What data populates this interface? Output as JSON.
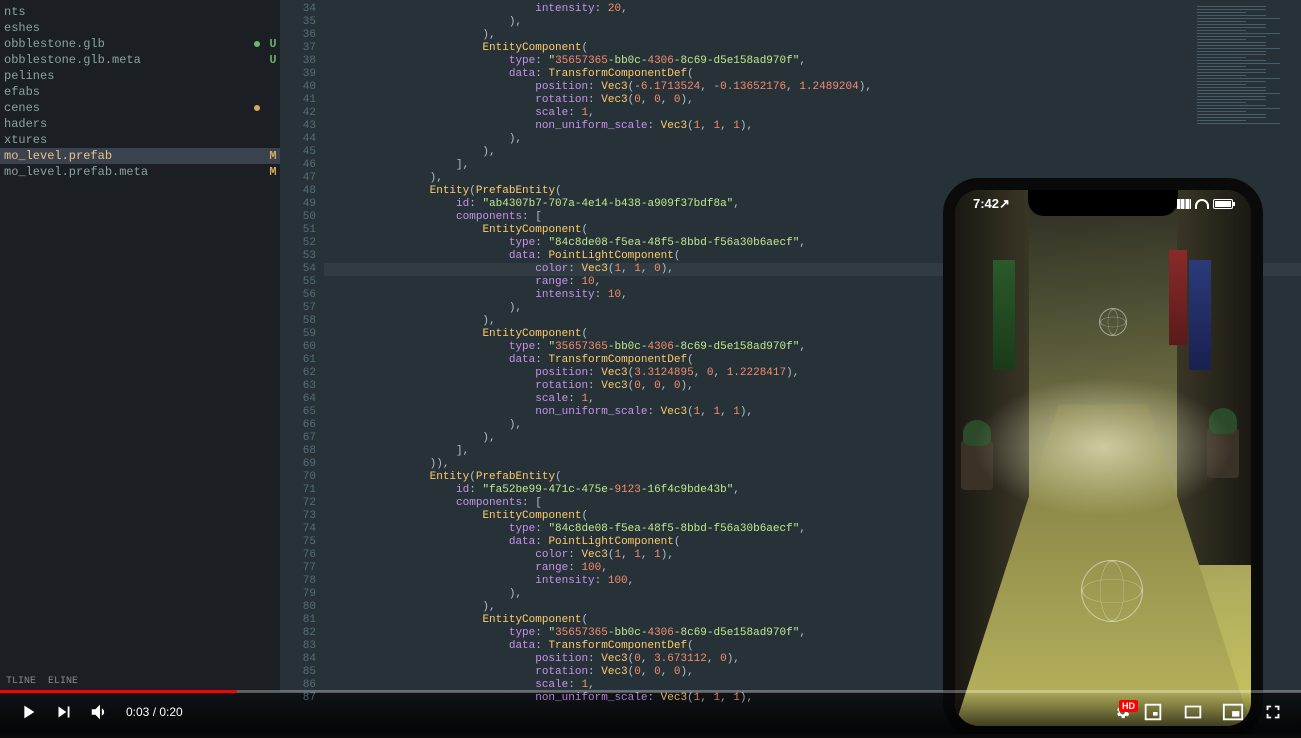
{
  "player": {
    "current_time": "0:03",
    "total_time": "0:20",
    "time_display": "0:03 / 0:20",
    "progress_percent": 18.2,
    "hd_badge": "HD"
  },
  "phone": {
    "time": "7:42",
    "location_icon": "↗"
  },
  "sidebar": {
    "items": [
      {
        "label": "nts",
        "badge": ""
      },
      {
        "label": "eshes",
        "badge": ""
      },
      {
        "label": "obblestone.glb",
        "badge": "U",
        "dot": "green"
      },
      {
        "label": "obblestone.glb.meta",
        "badge": "U"
      },
      {
        "label": "pelines",
        "badge": ""
      },
      {
        "label": "efabs",
        "badge": ""
      },
      {
        "label": "cenes",
        "badge": "",
        "dot": "orange"
      },
      {
        "label": "haders",
        "badge": ""
      },
      {
        "label": "xtures",
        "badge": ""
      },
      {
        "label": "mo_level.prefab",
        "badge": "M",
        "sel": true
      },
      {
        "label": "mo_level.prefab.meta",
        "badge": "M"
      }
    ],
    "bottom_tabs": [
      "TLINE",
      "ELINE"
    ]
  },
  "code_lines": [
    {
      "n": 34,
      "t": "                                intensity: 20,"
    },
    {
      "n": 35,
      "t": "                            ),"
    },
    {
      "n": 36,
      "t": "                        ),"
    },
    {
      "n": 37,
      "t": "                        EntityComponent("
    },
    {
      "n": 38,
      "t": "                            type: \"35657365-bb0c-4306-8c69-d5e158ad970f\","
    },
    {
      "n": 39,
      "t": "                            data: TransformComponentDef("
    },
    {
      "n": 40,
      "t": "                                position: Vec3(-6.1713524, -0.13652176, 1.2489204),"
    },
    {
      "n": 41,
      "t": "                                rotation: Vec3(0, 0, 0),"
    },
    {
      "n": 42,
      "t": "                                scale: 1,"
    },
    {
      "n": 43,
      "t": "                                non_uniform_scale: Vec3(1, 1, 1),"
    },
    {
      "n": 44,
      "t": "                            ),"
    },
    {
      "n": 45,
      "t": "                        ),"
    },
    {
      "n": 46,
      "t": "                    ],"
    },
    {
      "n": 47,
      "t": "                ),"
    },
    {
      "n": 48,
      "t": "                Entity(PrefabEntity("
    },
    {
      "n": 49,
      "t": "                    id: \"ab4307b7-707a-4e14-b438-a909f37bdf8a\","
    },
    {
      "n": 50,
      "t": "                    components: ["
    },
    {
      "n": 51,
      "t": "                        EntityComponent("
    },
    {
      "n": 52,
      "t": "                            type: \"84c8de08-f5ea-48f5-8bbd-f56a30b6aecf\","
    },
    {
      "n": 53,
      "t": "                            data: PointLightComponent("
    },
    {
      "n": 54,
      "t": "                                color: Vec3(1, 1, 0),",
      "hl": true
    },
    {
      "n": 55,
      "t": "                                range: 10,"
    },
    {
      "n": 56,
      "t": "                                intensity: 10,"
    },
    {
      "n": 57,
      "t": "                            ),"
    },
    {
      "n": 58,
      "t": "                        ),"
    },
    {
      "n": 59,
      "t": "                        EntityComponent("
    },
    {
      "n": 60,
      "t": "                            type: \"35657365-bb0c-4306-8c69-d5e158ad970f\","
    },
    {
      "n": 61,
      "t": "                            data: TransformComponentDef("
    },
    {
      "n": 62,
      "t": "                                position: Vec3(3.3124895, 0, 1.2228417),"
    },
    {
      "n": 63,
      "t": "                                rotation: Vec3(0, 0, 0),"
    },
    {
      "n": 64,
      "t": "                                scale: 1,"
    },
    {
      "n": 65,
      "t": "                                non_uniform_scale: Vec3(1, 1, 1),"
    },
    {
      "n": 66,
      "t": "                            ),"
    },
    {
      "n": 67,
      "t": "                        ),"
    },
    {
      "n": 68,
      "t": "                    ],"
    },
    {
      "n": 69,
      "t": "                )),"
    },
    {
      "n": 70,
      "t": "                Entity(PrefabEntity("
    },
    {
      "n": 71,
      "t": "                    id: \"fa52be99-471c-475e-9123-16f4c9bde43b\","
    },
    {
      "n": 72,
      "t": "                    components: ["
    },
    {
      "n": 73,
      "t": "                        EntityComponent("
    },
    {
      "n": 74,
      "t": "                            type: \"84c8de08-f5ea-48f5-8bbd-f56a30b6aecf\","
    },
    {
      "n": 75,
      "t": "                            data: PointLightComponent("
    },
    {
      "n": 76,
      "t": "                                color: Vec3(1, 1, 1),"
    },
    {
      "n": 77,
      "t": "                                range: 100,"
    },
    {
      "n": 78,
      "t": "                                intensity: 100,"
    },
    {
      "n": 79,
      "t": "                            ),"
    },
    {
      "n": 80,
      "t": "                        ),"
    },
    {
      "n": 81,
      "t": "                        EntityComponent("
    },
    {
      "n": 82,
      "t": "                            type: \"35657365-bb0c-4306-8c69-d5e158ad970f\","
    },
    {
      "n": 83,
      "t": "                            data: TransformComponentDef("
    },
    {
      "n": 84,
      "t": "                                position: Vec3(0, 3.673112, 0),"
    },
    {
      "n": 85,
      "t": "                                rotation: Vec3(0, 0, 0),"
    },
    {
      "n": 86,
      "t": "                                scale: 1,"
    },
    {
      "n": 87,
      "t": "                                non_uniform_scale: Vec3(1, 1, 1),"
    }
  ]
}
